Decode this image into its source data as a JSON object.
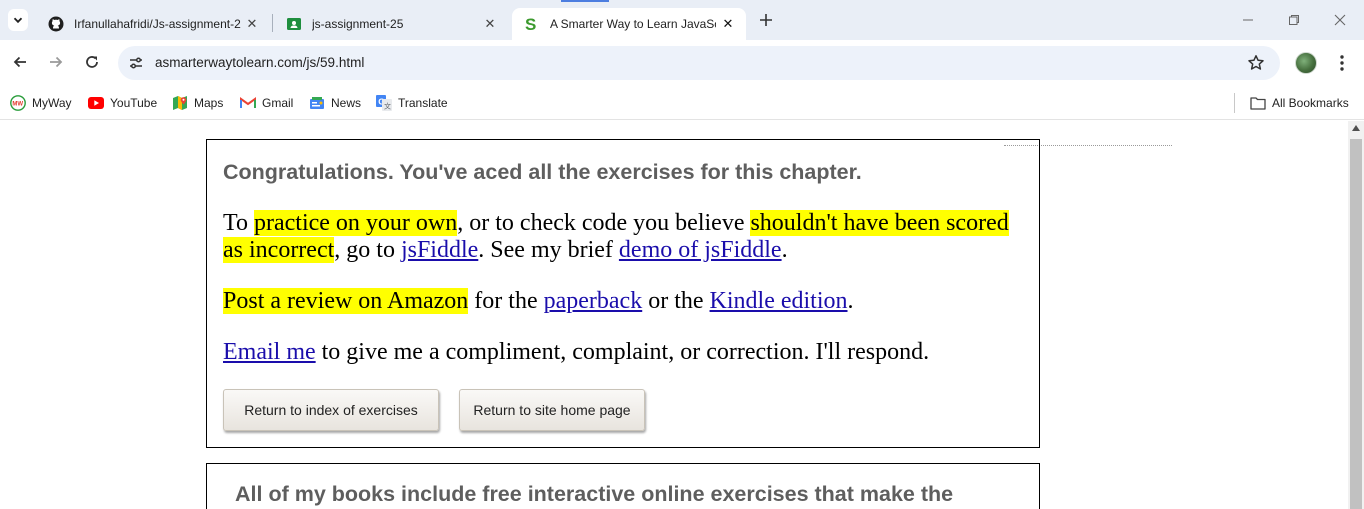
{
  "tabs": [
    {
      "title": "Irfanullahafridi/Js-assignment-2",
      "icon": "github-icon",
      "active": false
    },
    {
      "title": "js-assignment-25",
      "icon": "classroom-icon",
      "active": false
    },
    {
      "title": "A Smarter Way to Learn JavaScr",
      "icon": "smarter-way-s-icon",
      "active": true
    }
  ],
  "address_bar": {
    "url": "asmarterwaytolearn.com/js/59.html"
  },
  "bookmarks": [
    {
      "label": "MyWay",
      "icon": "myway-icon"
    },
    {
      "label": "YouTube",
      "icon": "youtube-icon"
    },
    {
      "label": "Maps",
      "icon": "maps-icon"
    },
    {
      "label": "Gmail",
      "icon": "gmail-icon"
    },
    {
      "label": "News",
      "icon": "news-icon"
    },
    {
      "label": "Translate",
      "icon": "translate-icon"
    }
  ],
  "all_bookmarks_label": "All Bookmarks",
  "content": {
    "heading": "Congratulations. You've aced all the exercises for this chapter.",
    "p1": {
      "t1": "To ",
      "h1": "practice on your own",
      "t2": ", or to check code you believe ",
      "h2": "shouldn't have been scored as incorrect",
      "t3": ", go to ",
      "link1": "jsFiddle",
      "t4": ". See my brief ",
      "link2": "demo of jsFiddle",
      "t5": "."
    },
    "p2": {
      "h1": "Post a review on Amazon",
      "t1": " for the ",
      "link1": "paperback",
      "t2": " or the ",
      "link2": "Kindle edition",
      "t3": "."
    },
    "p3": {
      "link1": "Email me",
      "t1": " to give me a compliment, complaint, or correction. I'll respond."
    },
    "buttons": {
      "index": "Return to index of exercises",
      "home": "Return to site home page"
    },
    "books_heading": "All of my books include free interactive online exercises that make the"
  },
  "colors": {
    "highlight": "#ffff00",
    "link": "#1a0dab",
    "heading": "#5e5e5e",
    "tabstrip": "#e9eef6"
  }
}
